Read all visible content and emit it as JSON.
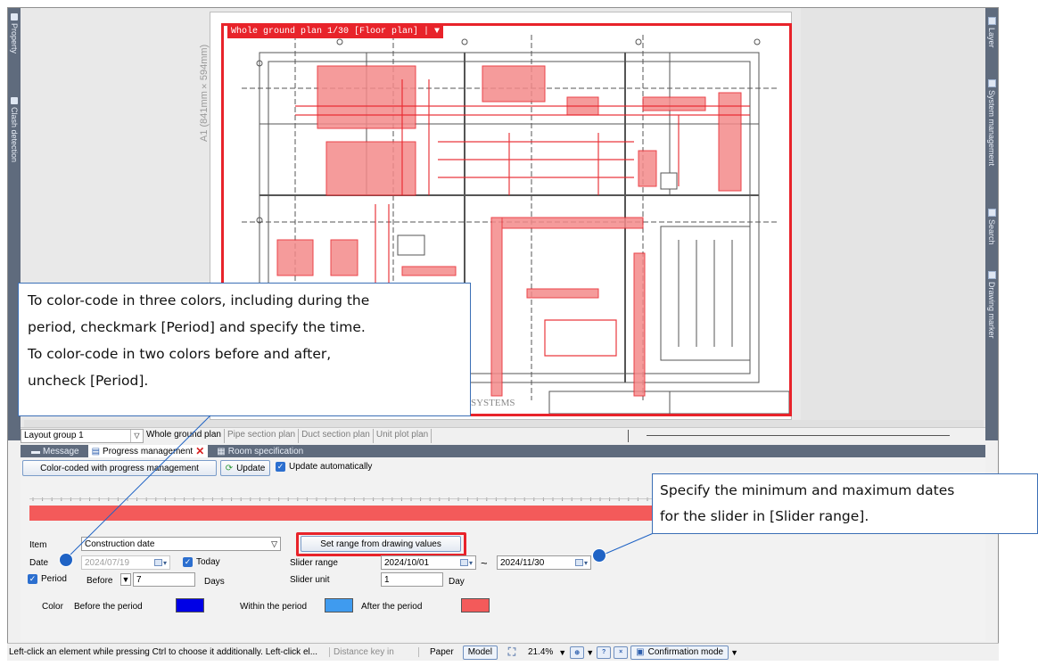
{
  "plan": {
    "paper_size_label": "A1 (841mm×594mm)",
    "banner_title": "Whole ground plan 1/30 [Floor plan]",
    "company_fragment": "SYSTEMS"
  },
  "left_sidebar": {
    "tabs": [
      {
        "label": "Property",
        "icon": "property-icon"
      },
      {
        "label": "Clash detection",
        "icon": "clash-detection-icon"
      }
    ]
  },
  "right_sidebar": {
    "tabs": [
      {
        "label": "Layer",
        "icon": "layer-icon"
      },
      {
        "label": "System management",
        "icon": "system-management-icon"
      },
      {
        "label": "Search",
        "icon": "search-icon"
      },
      {
        "label": "Drawing marker",
        "icon": "drawing-marker-icon"
      }
    ]
  },
  "tabbar": {
    "layout_group": "Layout group 1",
    "plan_tabs": [
      "Whole ground plan",
      "Pipe section plan",
      "Duct section plan",
      "Unit plot plan"
    ]
  },
  "panel_tabs": {
    "message": "Message",
    "progress": "Progress management",
    "room": "Room specification"
  },
  "panel": {
    "color_coded_button": "Color-coded with progress management",
    "update_button": "Update",
    "update_auto_label": "Update automatically",
    "item_label": "Item",
    "item_value": "Construction date",
    "set_range_button": "Set range from drawing values",
    "date_label": "Date",
    "date_value": "2024/07/19",
    "today_label": "Today",
    "slider_range_label": "Slider range",
    "slider_range_from": "2024/10/01",
    "slider_range_sep": "~",
    "slider_range_to": "2024/11/30",
    "slider_unit_label": "Slider unit",
    "slider_unit_value": "1",
    "slider_unit_suffix": "Day",
    "period_label": "Period",
    "before_label": "Before",
    "before_value": "7",
    "days_label": "Days",
    "color_label": "Color",
    "before_period_label": "Before the period",
    "within_period_label": "Within the period",
    "after_period_label": "After the period",
    "colors": {
      "before": "#0000e6",
      "within": "#3f9bef",
      "after": "#f35a5a",
      "accent_red": "#e8232a",
      "accent_blue": "#1f63c5"
    }
  },
  "status": {
    "message": "Left-click an element while pressing Ctrl to choose it additionally. Left-click el...",
    "distance_key": "Distance key in",
    "paper": "Paper",
    "model": "Model",
    "zoom": "21.4%",
    "confirmation_mode": "Confirmation mode"
  },
  "callouts": {
    "period_note": [
      "To color-code in three colors, including during the",
      "period, checkmark [Period] and specify the time.",
      "To color-code in two colors before and after,",
      "uncheck [Period]."
    ],
    "slider_note": [
      "Specify the minimum and maximum dates",
      "for the slider in [Slider range]."
    ]
  }
}
